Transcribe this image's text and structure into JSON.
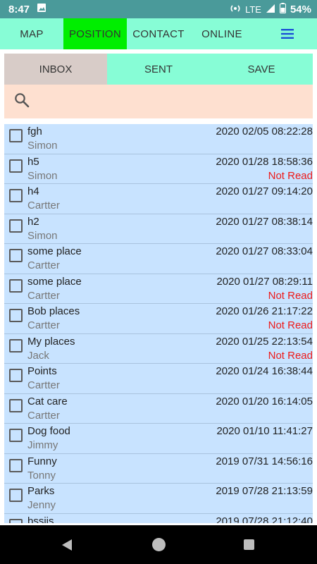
{
  "status_bar": {
    "time": "8:47",
    "network": "LTE",
    "battery": "54%"
  },
  "top_nav": {
    "tabs": [
      {
        "label": "MAP"
      },
      {
        "label": "POSITION"
      },
      {
        "label": "CONTACT"
      },
      {
        "label": "ONLINE"
      }
    ],
    "active_tab": "POSITION",
    "menu_icon": "hamburger-menu-icon",
    "colors": {
      "bar": "#87fdd6",
      "active": "#00ee00",
      "menu_icon": "#1a4fd6"
    }
  },
  "sub_tabs": {
    "tabs": [
      {
        "label": "INBOX"
      },
      {
        "label": "SENT"
      },
      {
        "label": "SAVE"
      }
    ],
    "active_tab": "INBOX",
    "colors": {
      "active": "#d8ccc8",
      "inactive": "#87fdd6"
    }
  },
  "search": {
    "icon": "search-icon",
    "value": "",
    "placeholder": ""
  },
  "messages": [
    {
      "subject": "fgh",
      "sender": "Simon",
      "date": "2020 02/05 08:22:28",
      "status": ""
    },
    {
      "subject": "h5",
      "sender": "Simon",
      "date": "2020 01/28 18:58:36",
      "status": "Not Read"
    },
    {
      "subject": "h4",
      "sender": "Cartter",
      "date": "2020 01/27 09:14:20",
      "status": ""
    },
    {
      "subject": "h2",
      "sender": "Simon",
      "date": "2020 01/27 08:38:14",
      "status": ""
    },
    {
      "subject": "some place",
      "sender": "Cartter",
      "date": "2020 01/27 08:33:04",
      "status": ""
    },
    {
      "subject": "some place",
      "sender": "Cartter",
      "date": "2020 01/27 08:29:11",
      "status": "Not Read"
    },
    {
      "subject": "Bob places",
      "sender": "Cartter",
      "date": "2020 01/26 21:17:22",
      "status": "Not Read"
    },
    {
      "subject": "My places",
      "sender": "Jack",
      "date": "2020 01/25 22:13:54",
      "status": "Not Read"
    },
    {
      "subject": "Points",
      "sender": "Cartter",
      "date": "2020 01/24 16:38:44",
      "status": ""
    },
    {
      "subject": "Cat care",
      "sender": "Cartter",
      "date": "2020 01/20 16:14:05",
      "status": ""
    },
    {
      "subject": "Dog food",
      "sender": "Jimmy",
      "date": "2020 01/10 11:41:27",
      "status": ""
    },
    {
      "subject": "Funny",
      "sender": "Tonny",
      "date": "2019 07/31 14:56:16",
      "status": ""
    },
    {
      "subject": "Parks",
      "sender": "Jenny",
      "date": "2019 07/28 21:13:59",
      "status": ""
    },
    {
      "subject": "bssjjs",
      "sender": "",
      "date": "2019 07/28 21:12:40",
      "status": ""
    }
  ],
  "colors": {
    "list_bg": "#c8e3ff",
    "search_bg": "#fee0d0",
    "not_read": "#ee1a1a",
    "status_bar": "#4a9a9a"
  },
  "system_nav": {
    "back_icon": "back-triangle-icon",
    "home_icon": "home-circle-icon",
    "recents_icon": "recents-square-icon"
  }
}
